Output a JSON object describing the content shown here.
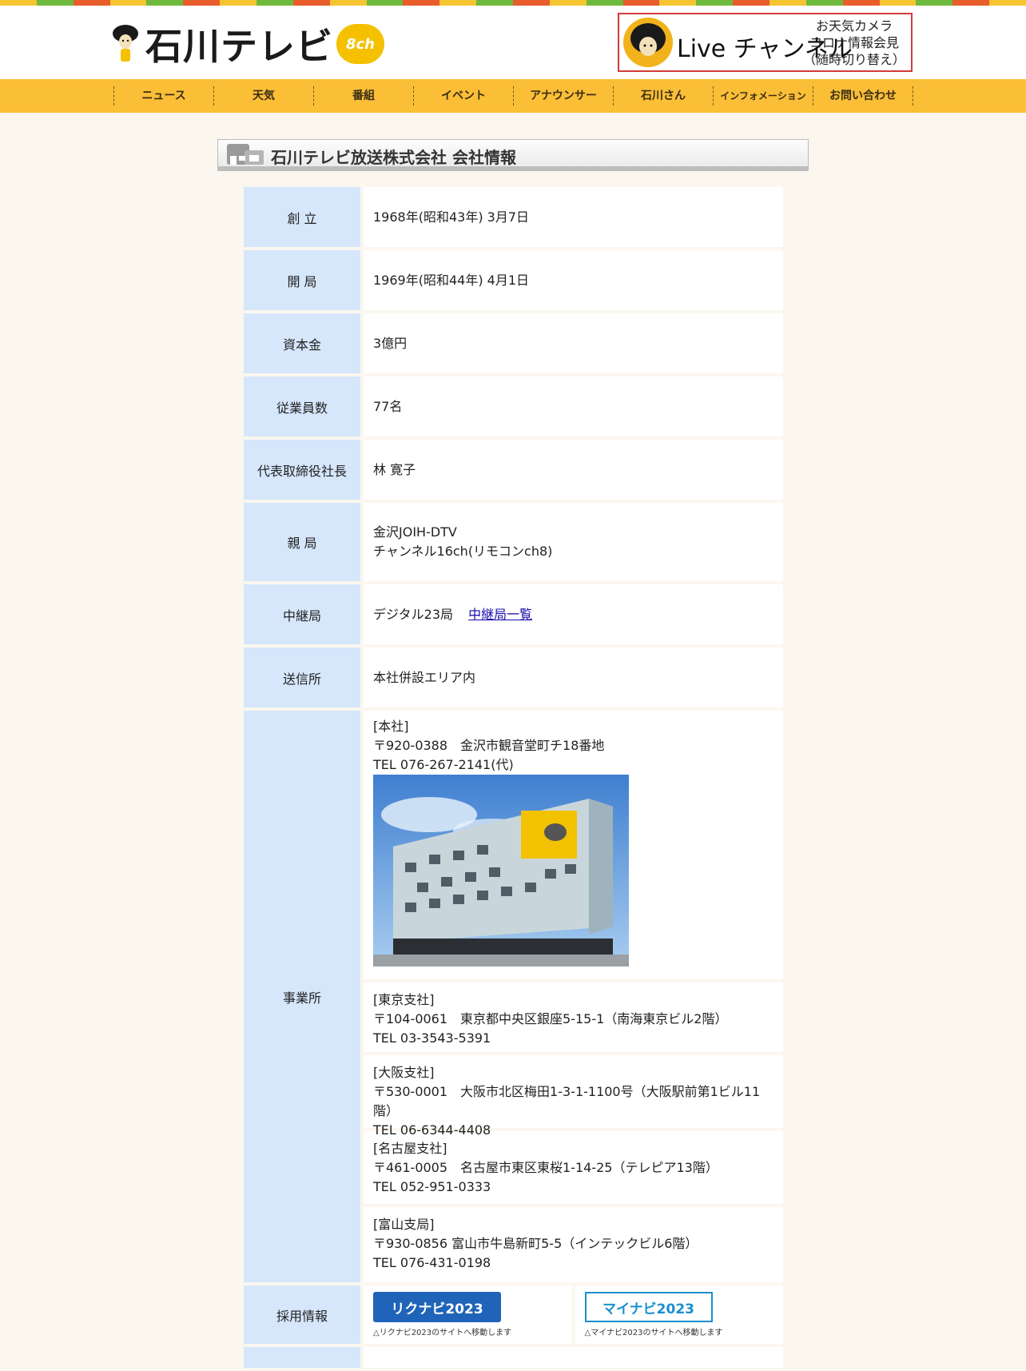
{
  "stripe_colors": [
    "#f5c431",
    "#6fba3c",
    "#e95c2c",
    "#f5c431",
    "#6fba3c",
    "#e95c2c",
    "#f5c431",
    "#6fba3c",
    "#e95c2c",
    "#f5c431",
    "#6fba3c",
    "#e95c2c",
    "#f5c431",
    "#6fba3c",
    "#e95c2c",
    "#f5c431",
    "#6fba3c",
    "#e95c2c",
    "#f5c431",
    "#6fba3c",
    "#e95c2c",
    "#f5c431",
    "#6fba3c",
    "#e95c2c",
    "#f5c431",
    "#6fba3c",
    "#e95c2c",
    "#f5c431"
  ],
  "header": {
    "logo_text": "石川テレビ",
    "logo_badge": "8ch",
    "live": {
      "title": "Live チャンネル",
      "sub1": "お天気カメラ",
      "sub2": "コロナ情報会見",
      "sub3": "（随時切り替え）"
    }
  },
  "nav": {
    "items": [
      "ニュース",
      "天気",
      "番組",
      "イベント",
      "アナウンサー",
      "石川さん",
      "インフォメーション",
      "お問い合わせ"
    ]
  },
  "page": {
    "title": "石川テレビ放送株式会社 会社情報"
  },
  "info": {
    "founded_label": "創 立",
    "founded": "1968年(昭和43年) 3月7日",
    "opened_label": "開 局",
    "opened": "1969年(昭和44年) 4月1日",
    "capital_label": "資本金",
    "capital": "3億円",
    "employees_label": "従業員数",
    "employees": "77名",
    "ceo_label": "代表取締役社長",
    "ceo": "林 寛子",
    "station_label": "親 局",
    "station_line1": "金沢JOIH-DTV",
    "station_line2": "チャンネル16ch(リモコンch8)",
    "relay_label": "中継局",
    "relay": "デジタル23局",
    "relay_link": "中継局一覧",
    "transmit_label": "送信所",
    "transmit": "本社併設エリア内",
    "offices_label": "事業所",
    "offices": {
      "hq_name": "[本社]",
      "hq_addr": "〒920-0388　金沢市観音堂町チ18番地",
      "hq_tel": "TEL 076-267-2141(代)",
      "tokyo_name": "[東京支社]",
      "tokyo_addr": "〒104-0061　東京都中央区銀座5-15-1（南海東京ビル2階）",
      "tokyo_tel": "TEL 03-3543-5391",
      "osaka_name": "[大阪支社]",
      "osaka_addr": "〒530-0001　大阪市北区梅田1-3-1-1100号（大阪駅前第1ビル11階）",
      "osaka_tel": "TEL 06-6344-4408",
      "nagoya_name": "[名古屋支社]",
      "nagoya_addr": "〒461-0005　名古屋市東区東桜1-14-25（テレピア13階）",
      "nagoya_tel": "TEL 052-951-0333",
      "toyama_name": "[富山支局]",
      "toyama_addr": "〒930-0856 富山市牛島新町5-5（インテックビル6階）",
      "toyama_tel": "TEL 076-431-0198"
    },
    "recruit_label": "採用情報",
    "rikunabi": "リクナビ2023",
    "rikunabi_note": "△リクナビ2023のサイトへ移動します",
    "mynavi": "マイナビ2023",
    "mynavi_note": "△マイナビ2023のサイトへ移動します"
  }
}
